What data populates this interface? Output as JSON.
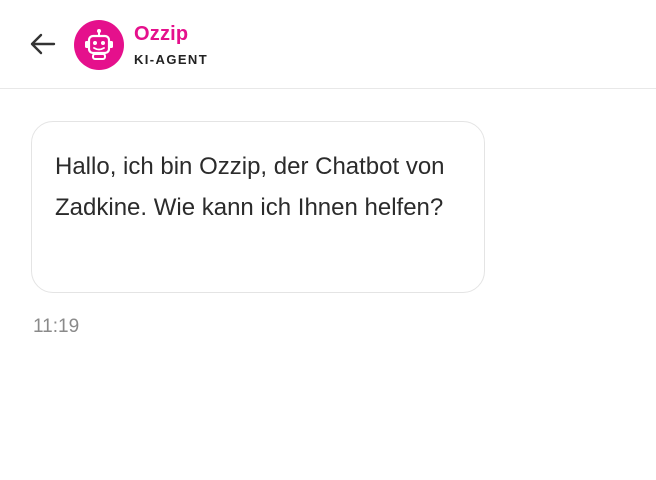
{
  "header": {
    "back_icon": "arrow-left-icon",
    "avatar_icon": "robot-icon",
    "agent_name": "Ozzip",
    "agent_role": "KI-AGENT",
    "brand_color": "#e5108c"
  },
  "conversation": {
    "messages": [
      {
        "sender": "bot",
        "text": "Hallo, ich bin Ozzip, der Chatbot von Zadkine. Wie kann ich Ihnen helfen?",
        "time": "11:19"
      }
    ]
  }
}
